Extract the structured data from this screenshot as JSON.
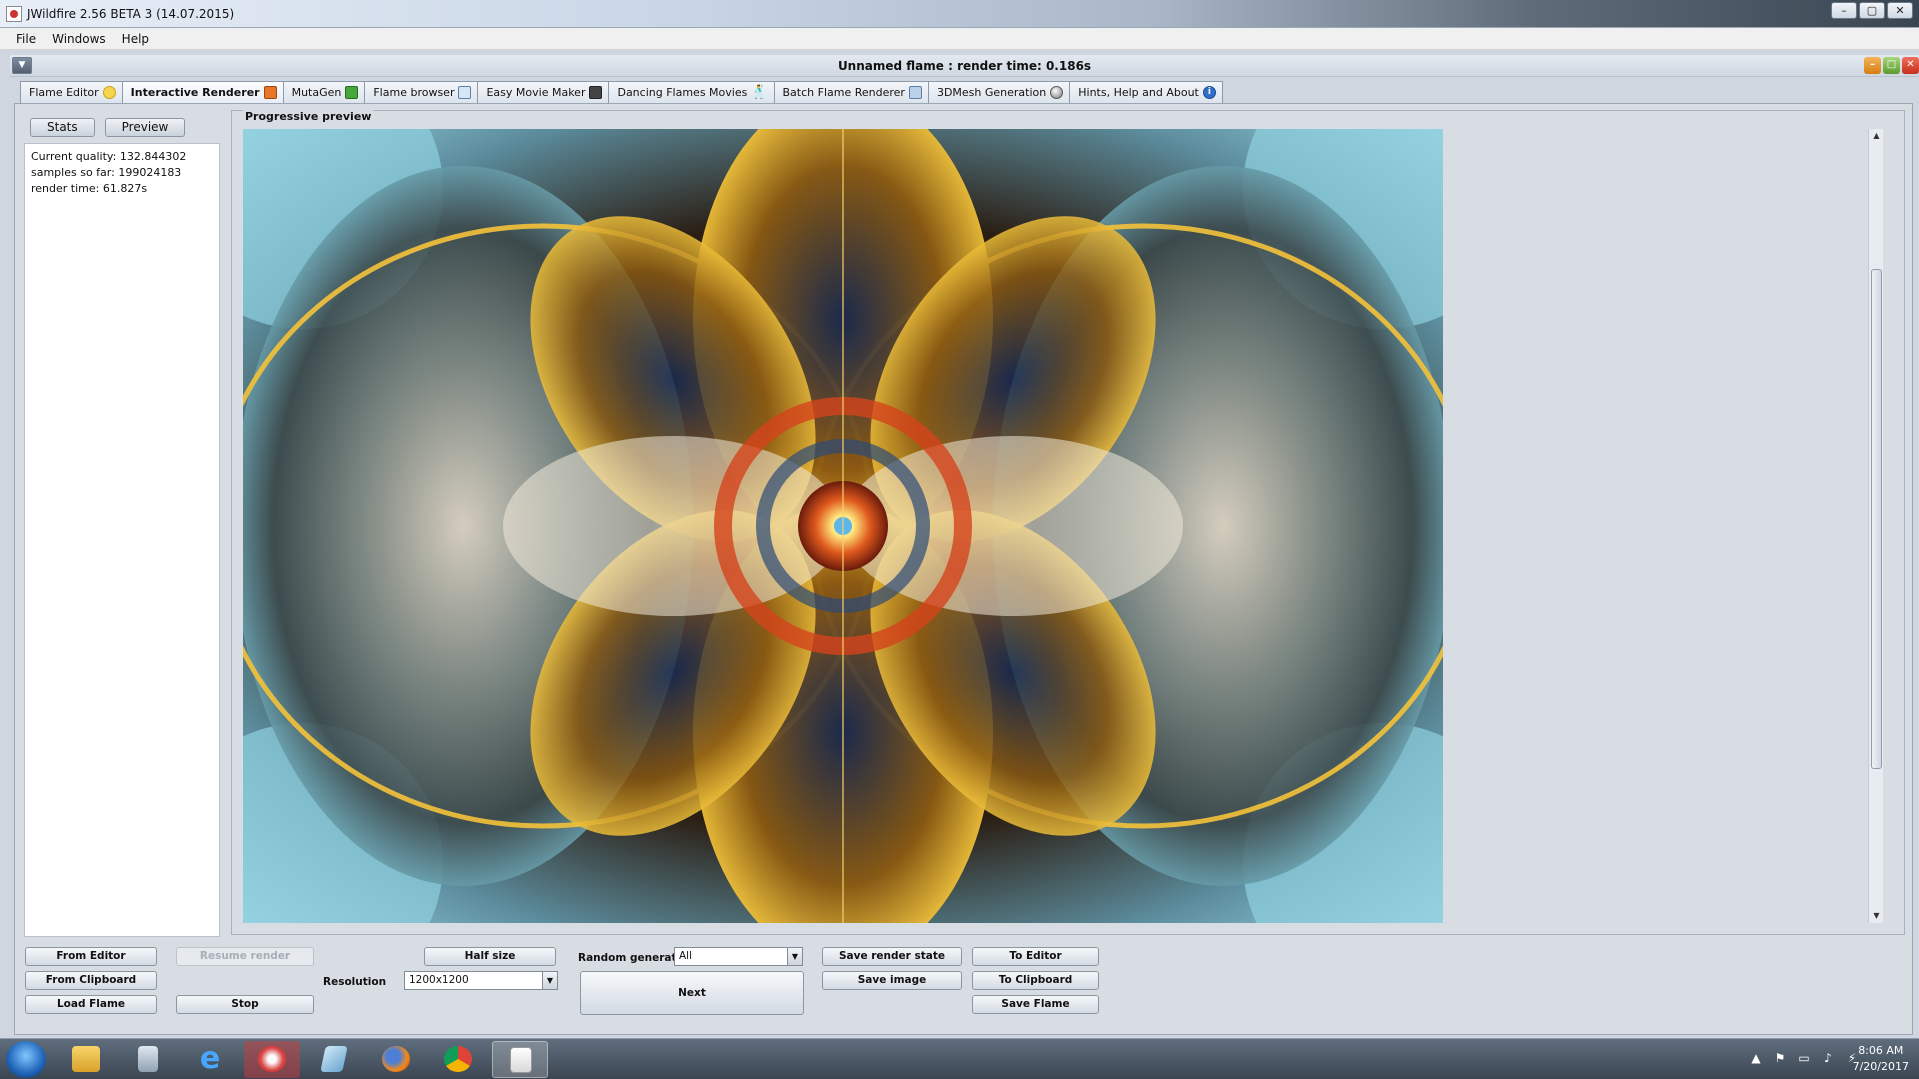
{
  "window": {
    "title": "JWildfire 2.56 BETA 3 (14.07.2015)"
  },
  "menu": [
    "File",
    "Windows",
    "Help"
  ],
  "frame": {
    "title": "Unnamed flame : render time: 0.186s"
  },
  "tabs": [
    {
      "label": "Flame Editor",
      "icon": "sun-icon"
    },
    {
      "label": "Interactive Renderer",
      "icon": "render-icon"
    },
    {
      "label": "MutaGen",
      "icon": "dna-icon"
    },
    {
      "label": "Flame browser",
      "icon": "grid-icon"
    },
    {
      "label": "Easy Movie Maker",
      "icon": "clapper-icon"
    },
    {
      "label": "Dancing Flames Movies",
      "icon": "dancer-icon"
    },
    {
      "label": "Batch Flame Renderer",
      "icon": "batch-icon"
    },
    {
      "label": "3DMesh Generation",
      "icon": "ball-icon"
    },
    {
      "label": "Hints, Help and About",
      "icon": "info-icon"
    }
  ],
  "left": {
    "stats_label": "Stats",
    "preview_label": "Preview",
    "stats": [
      "Current quality: 132.844302",
      "samples so far: 199024183",
      "render time: 61.827s"
    ]
  },
  "preview": {
    "title": "Progressive preview"
  },
  "controls": {
    "from_editor": "From Editor",
    "from_clipboard": "From Clipboard",
    "load_flame": "Load Flame",
    "resume_render": "Resume render",
    "stop": "Stop",
    "resolution_label": "Resolution",
    "resolution_value": "1200x1200",
    "half_size": "Half size",
    "random_generator_label": "Random generator",
    "random_generator_value": "All",
    "next": "Next",
    "save_render_state": "Save render state",
    "save_image": "Save image",
    "to_editor": "To Editor",
    "to_clipboard": "To Clipboard",
    "save_flame": "Save Flame"
  },
  "taskbar": {
    "time": "8:06 AM",
    "date": "7/20/2017",
    "apps": [
      "explorer-icon",
      "calculator-icon",
      "ie-icon",
      "snipping-icon",
      "notepad-icon",
      "firefox-icon",
      "chrome-icon",
      "java-icon"
    ]
  }
}
